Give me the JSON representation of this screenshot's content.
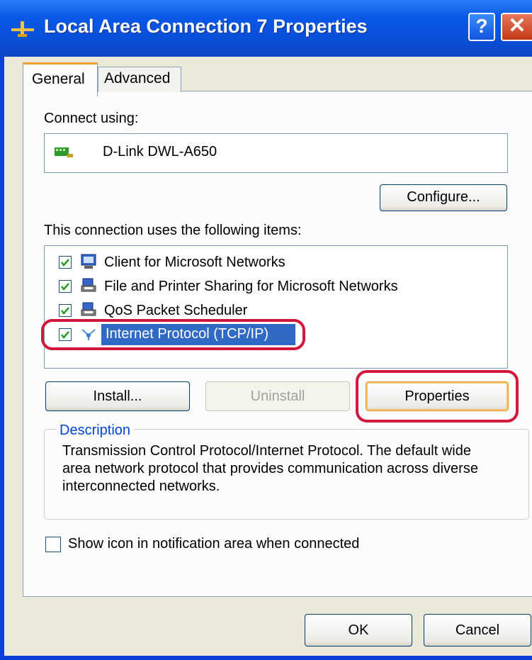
{
  "window": {
    "title": "Local Area Connection 7 Properties",
    "help_glyph": "?",
    "close_glyph": "✕"
  },
  "tabs": [
    {
      "label": "General",
      "selected": true
    },
    {
      "label": "Advanced",
      "selected": false
    }
  ],
  "connect_using": {
    "label": "Connect using:",
    "adapter": "D-Link DWL-A650",
    "configure_button": "Configure..."
  },
  "items_section": {
    "label": "This connection uses the following items:",
    "items": [
      {
        "label": "Client for Microsoft Networks",
        "checked": true,
        "icon": "network-client-icon",
        "selected": false
      },
      {
        "label": "File and Printer Sharing for Microsoft Networks",
        "checked": true,
        "icon": "file-printer-sharing-icon",
        "selected": false
      },
      {
        "label": "QoS Packet Scheduler",
        "checked": true,
        "icon": "qos-scheduler-icon",
        "selected": false
      },
      {
        "label": "Internet Protocol (TCP/IP)",
        "checked": true,
        "icon": "protocol-icon",
        "selected": true
      }
    ]
  },
  "buttons": {
    "install": "Install...",
    "uninstall": "Uninstall",
    "properties": "Properties",
    "ok": "OK",
    "cancel": "Cancel"
  },
  "description": {
    "title": "Description",
    "text": "Transmission Control Protocol/Internet Protocol. The default wide area network protocol that provides communication across diverse interconnected networks."
  },
  "show_icon_checkbox": {
    "label": "Show icon in notification area when connected",
    "checked": false
  },
  "colors": {
    "title_bar": "#0a4fd6",
    "selection": "#316ac5",
    "highlight_ring": "#d4183c",
    "dialog_face": "#ece9d8"
  }
}
